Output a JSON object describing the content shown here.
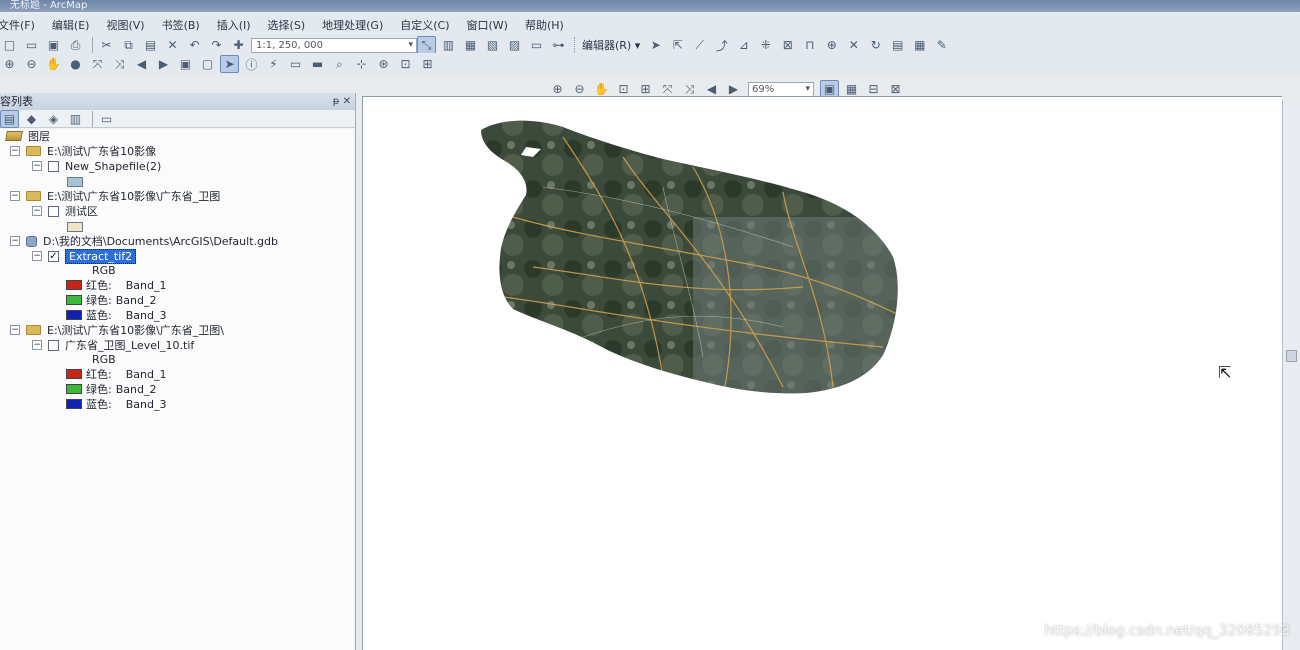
{
  "app": {
    "title": "无标题 - ArcMap"
  },
  "menu": [
    "文件(F)",
    "编辑(E)",
    "视图(V)",
    "书签(B)",
    "插入(I)",
    "选择(S)",
    "地理处理(G)",
    "自定义(C)",
    "窗口(W)",
    "帮助(H)"
  ],
  "toolbar": {
    "scale_value": "1:1, 250, 000",
    "editor_label": "编辑器(R) ▾",
    "zoom_value": "69%"
  },
  "toc": {
    "title": "容列表",
    "header_buttons": "ᵽ ✕",
    "root_label": "图层",
    "groups": [
      {
        "path": "E:\\测试\\广东省10影像",
        "layer": "New_Shapefile(2)",
        "symbol_color": "#a9c3d6"
      },
      {
        "path": "E:\\测试\\广东省10影像\\广东省_卫图",
        "layer": "测试区",
        "symbol_color": "#efe6c8"
      },
      {
        "path": "D:\\我的文档\\Documents\\ArcGIS\\Default.gdb",
        "layer": "Extract_tif2",
        "rgb": "RGB",
        "bands": [
          {
            "label": "红色:",
            "band": "Band_1",
            "color": "#c8241c"
          },
          {
            "label": "绿色:",
            "band": "Band_2",
            "color": "#3cb83a"
          },
          {
            "label": "蓝色:",
            "band": "Band_3",
            "color": "#1022b6"
          }
        ]
      },
      {
        "path": "E:\\测试\\广东省10影像\\广东省_卫图\\",
        "layer": "广东省_卫图_Level_10.tif",
        "rgb": "RGB",
        "bands": [
          {
            "label": "红色:",
            "band": "Band_1",
            "color": "#c8241c"
          },
          {
            "label": "绿色:",
            "band": "Band_2",
            "color": "#3cb83a"
          },
          {
            "label": "蓝色:",
            "band": "Band_3",
            "color": "#1022b6"
          }
        ]
      }
    ]
  },
  "watermark": "https://blog.csdn.net/qq_32085293"
}
